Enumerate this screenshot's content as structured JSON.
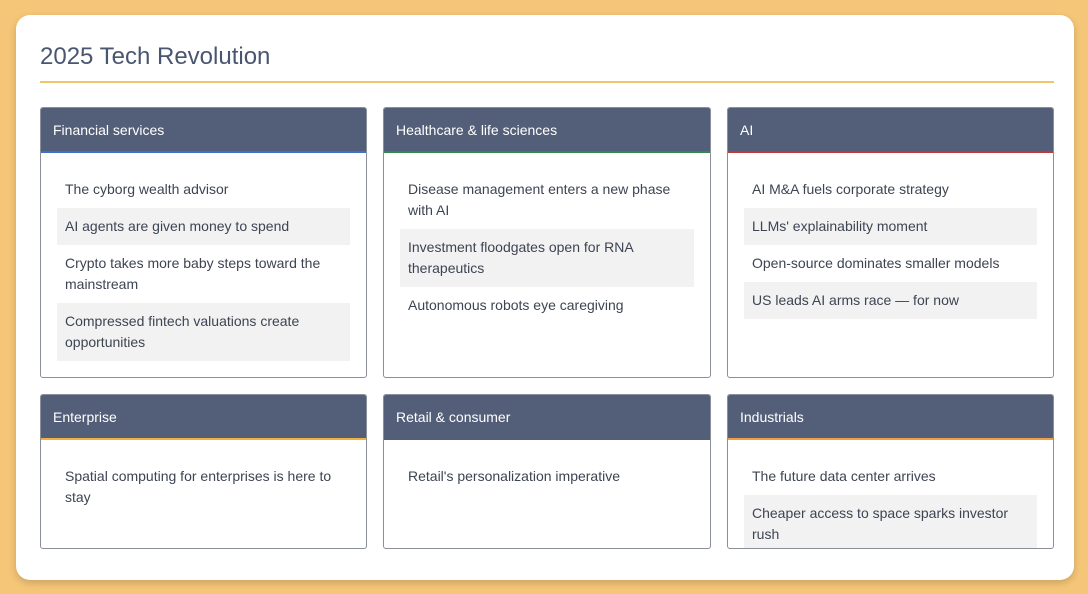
{
  "page": {
    "title": "2025 Tech Revolution"
  },
  "colors": {
    "background": "#f6c678",
    "header_bg": "#535f78",
    "title_rule": "#f0c66a",
    "accent_financial": "#3b73c9",
    "accent_healthcare": "#2e8a50",
    "accent_ai": "#c0393b",
    "accent_enterprise": "#f0b23a",
    "accent_industrials": "#f0a040"
  },
  "sections": [
    {
      "name": "Financial services",
      "accent": "#3b73c9",
      "topics": [
        "The cyborg wealth advisor",
        "AI agents are given money to spend",
        "Crypto takes more baby steps toward the mainstream",
        "Compressed fintech valuations create opportunities"
      ]
    },
    {
      "name": "Healthcare & life sciences",
      "accent": "#2e8a50",
      "topics": [
        "Disease management enters a new phase with AI",
        "Investment floodgates open for RNA therapeutics",
        "Autonomous robots eye caregiving"
      ]
    },
    {
      "name": "AI",
      "accent": "#c0393b",
      "topics": [
        "AI M&A fuels corporate strategy",
        "LLMs' explainability moment",
        "Open-source dominates smaller models",
        "US leads AI arms race — for now"
      ]
    },
    {
      "name": "Enterprise",
      "accent": "#f0b23a",
      "topics": [
        "Spatial computing for enterprises is here to stay"
      ]
    },
    {
      "name": "Retail & consumer",
      "accent": "",
      "topics": [
        "Retail's personalization imperative"
      ]
    },
    {
      "name": "Industrials",
      "accent": "#f0a040",
      "topics": [
        "The future data center arrives",
        "Cheaper access to space sparks investor rush"
      ]
    }
  ]
}
